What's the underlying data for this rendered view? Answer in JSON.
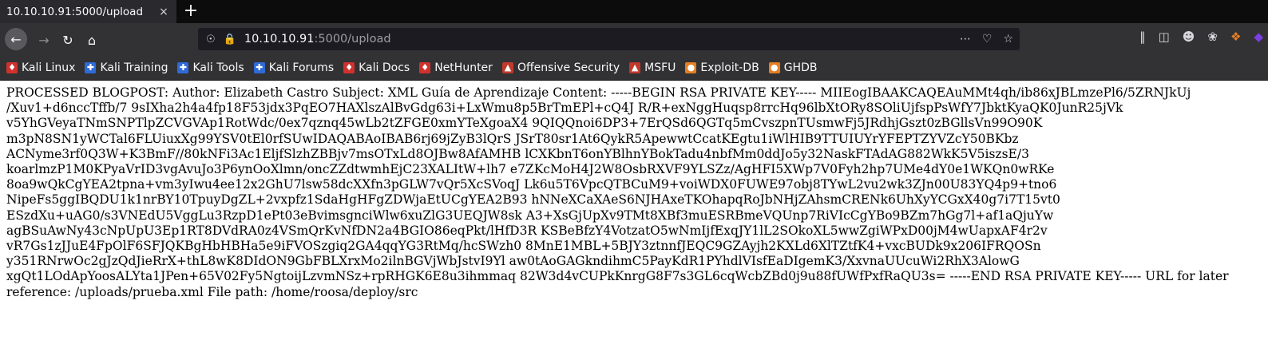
{
  "tab": {
    "title": "10.10.10.91:5000/upload",
    "close": "×",
    "new": "+"
  },
  "url": {
    "host": "10.10.10.91",
    "rest": ":5000/upload"
  },
  "bookmarks": [
    {
      "label": "Kali Linux",
      "color": "#d0312d"
    },
    {
      "label": "Kali Training",
      "color": "#2f6bd8"
    },
    {
      "label": "Kali Tools",
      "color": "#2f6bd8"
    },
    {
      "label": "Kali Forums",
      "color": "#2f6bd8"
    },
    {
      "label": "Kali Docs",
      "color": "#d0312d"
    },
    {
      "label": "NetHunter",
      "color": "#d0312d"
    },
    {
      "label": "Offensive Security",
      "color": "#c0392b"
    },
    {
      "label": "MSFU",
      "color": "#c0392b"
    },
    {
      "label": "Exploit-DB",
      "color": "#e67e22"
    },
    {
      "label": "GHDB",
      "color": "#e67e22"
    }
  ],
  "content_lines": [
    "PROCESSED BLOGPOST: Author: Elizabeth Castro Subject: XML Guía de Aprendizaje Content: -----BEGIN RSA PRIVATE KEY----- MIIEogIBAAKCAQEAuMMt4qh/ib86xJBLmzePl6/5ZRNJkUj",
    "/Xuv1+d6nccTffb/7 9sIXha2h4a4fp18F53jdx3PqEO7HAXlszAlBvGdg63i+LxWmu8p5BrTmEPl+cQ4J R/R+exNggHuqsp8rrcHq96lbXtORy8SOliUjfspPsWfY7JbktKyaQK0JunR25jVk",
    "v5YhGVeyaTNmSNPTlpZCVGVAp1RotWdc/0ex7qznq45wLb2tZFGE0xmYTeXgoaX4 9QIQQnoi6DP3+7ErQSd6QGTq5mCvszpnTUsmwFj5JRdhjGszt0zBGllsVn99O90K",
    "m3pN8SN1yWCTal6FLUiuxXg99YSV0tEl0rfSUwIDAQABAoIBAB6rj69jZyB3lQrS JSrT80sr1At6QykR5ApewwtCcatKEgtu1iWlHIB9TTUIUYrYFEPTZYVZcY50BKbz",
    "ACNyme3rf0Q3W+K3BmF//80kNFi3Ac1EljfSlzhZBBjv7msOTxLd8OJBw8AfAMHB lCXKbnT6onYBlhnYBokTadu4nbfMm0ddJo5y32NaskFTAdAG882WkK5V5iszsE/3",
    "koarlmzP1M0KPyaVrID3vgAvuJo3P6ynOoXlmn/oncZZdtwmhEjC23XALItW+lh7 e7ZKcMoH4J2W8OsbRXVF9YLSZz/AgHFI5XWp7V0Fyh2hp7UMe4dY0e1WKQn0wRKe",
    "8oa9wQkCgYEA2tpna+vm3yIwu4ee12x2GhU7lsw58dcXXfn3pGLW7vQr5XcSVoqJ Lk6u5T6VpcQTBCuM9+voiWDX0FUWE97obj8TYwL2vu2wk3ZJn00U83YQ4p9+tno6",
    "NipeFs5ggIBQDU1k1nrBY10TpuyDgZL+2vxpfz1SdaHgHFgZDWjaEtUCgYEA2B93 hNNeXCaXAeS6NJHAxeTKOhapqRoJbNHjZAhsmCRENk6UhXyYCGxX40g7i7T15vt0",
    "ESzdXu+uAG0/s3VNEdU5VggLu3RzpD1ePt03eBvimsgnciWlw6xuZlG3UEQJW8sk A3+XsGjUpXv9TMt8XBf3muESRBmeVQUnp7RiVIcCgYBo9BZm7hGg7l+af1aQjuYw",
    "agBSuAwNy43cNpUpU3Ep1RT8DVdRA0z4VSmQrKvNfDN2a4BGIO86eqPkt/lHfD3R KSBeBfzY4VotzatO5wNmIjfExqJY1lL2SOkoXL5wwZgiWPxD00jM4wUapxAF4r2v",
    "vR7Gs1zJJuE4FpOlF6SFJQKBgHbHBHa5e9iFVOSzgiq2GA4qqYG3RtMq/hcSWzh0 8MnE1MBL+5BJY3ztnnfJEQC9GZAyjh2KXLd6XlTZtfK4+vxcBUDk9x206IFRQOSn",
    "y351RNrwOc2gJzQdJieRrX+thL8wK8DIdON9GbFBLXrxMo2ilnBGVjWbJstvI9Yl aw0tAoGAGkndihmC5PayKdR1PYhdlVIsfEaDIgemK3/XxvnaUUcuWi2RhX3AlowG",
    "xgQt1LOdApYoosALYta1JPen+65V02Fy5NgtoijLzvmNSz+rpRHGK6E8u3ihmmaq 82W3d4vCUPkKnrgG8F7s3GL6cqWcbZBd0j9u88fUWfPxfRaQU3s= -----END RSA PRIVATE KEY----- URL for later",
    "reference: /uploads/prueba.xml File path: /home/roosa/deploy/src"
  ]
}
